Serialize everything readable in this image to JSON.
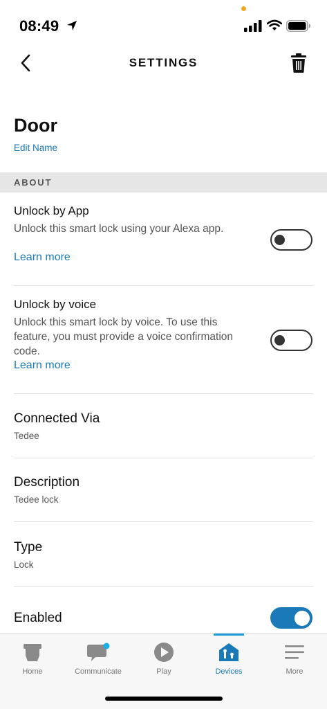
{
  "status_bar": {
    "time": "08:49",
    "icons": [
      "location-arrow-icon",
      "signal-icon",
      "wifi-icon",
      "battery-icon"
    ]
  },
  "nav": {
    "title": "SETTINGS",
    "back_icon": "chevron-left-icon",
    "delete_icon": "trash-icon"
  },
  "device": {
    "name": "Door",
    "edit_label": "Edit Name"
  },
  "section": {
    "header": "ABOUT"
  },
  "unlock_app": {
    "title": "Unlock by App",
    "description": "Unlock this smart lock using your Alexa app.",
    "learn_more": "Learn more",
    "enabled": false
  },
  "unlock_voice": {
    "title": "Unlock by voice",
    "description": "Unlock this smart lock by voice. To use this feature, you must provide a voice confirmation code.",
    "learn_more": "Learn more",
    "enabled": false
  },
  "connected_via": {
    "label": "Connected Via",
    "value": "Tedee"
  },
  "description_row": {
    "label": "Description",
    "value": "Tedee lock"
  },
  "type_row": {
    "label": "Type",
    "value": "Lock"
  },
  "enabled_row": {
    "label": "Enabled",
    "enabled": true
  },
  "tabs": [
    {
      "label": "Home",
      "icon": "home-icon",
      "active": false
    },
    {
      "label": "Communicate",
      "icon": "chat-bubble-icon",
      "active": false
    },
    {
      "label": "Play",
      "icon": "play-icon",
      "active": false
    },
    {
      "label": "Devices",
      "icon": "devices-icon",
      "active": true
    },
    {
      "label": "More",
      "icon": "menu-icon",
      "active": false
    }
  ],
  "colors": {
    "accent": "#1a7ab8",
    "indicator": "#1a9bd7",
    "notification_dot": "#1ab0e6",
    "status_orange": "#f5a623"
  }
}
